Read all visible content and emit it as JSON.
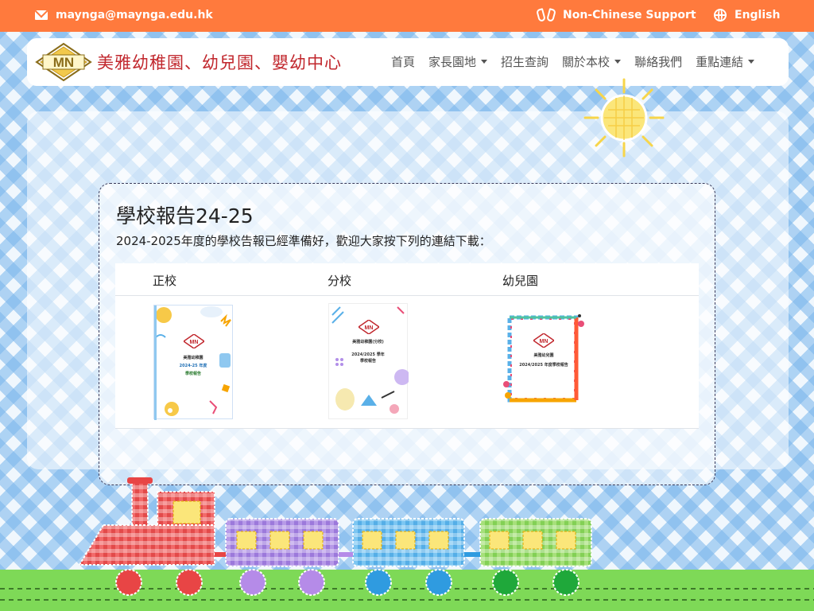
{
  "topbar": {
    "email": "maynga@maynga.edu.hk",
    "support": "Non-Chinese Support",
    "language": "English"
  },
  "navbar": {
    "logo_text": "MN",
    "brand": "美雅幼稚園、幼兒園、嬰幼中心",
    "menu": [
      {
        "label": "首頁",
        "dropdown": false
      },
      {
        "label": "家長園地",
        "dropdown": true
      },
      {
        "label": "招生查詢",
        "dropdown": false
      },
      {
        "label": "關於本校",
        "dropdown": true
      },
      {
        "label": "聯絡我們",
        "dropdown": false
      },
      {
        "label": "重點連結",
        "dropdown": true
      }
    ]
  },
  "content": {
    "title": "學校報告24-25",
    "intro": "2024-2025年度的學校告報已經準備好，歡迎大家按下列的連結下載：",
    "columns": [
      "正校",
      "分校",
      "幼兒園"
    ],
    "covers": [
      {
        "line1": "美雅幼稚園",
        "line2": "2024-25 年度",
        "line3": "學校報告"
      },
      {
        "line1": "美雅幼稚園(分校)",
        "line2": "2024/2025 學年",
        "line3": "學校報告"
      },
      {
        "line1": "美雅幼兒園",
        "line2": "2024/2025 年度學校報告",
        "line3": ""
      }
    ]
  },
  "colors": {
    "topbar": "#ff7a3d",
    "brand": "#c1272d",
    "grass": "#7ed957"
  },
  "icons": [
    "envelope-icon",
    "sign-language-icon",
    "globe-icon",
    "caret-down-icon"
  ]
}
